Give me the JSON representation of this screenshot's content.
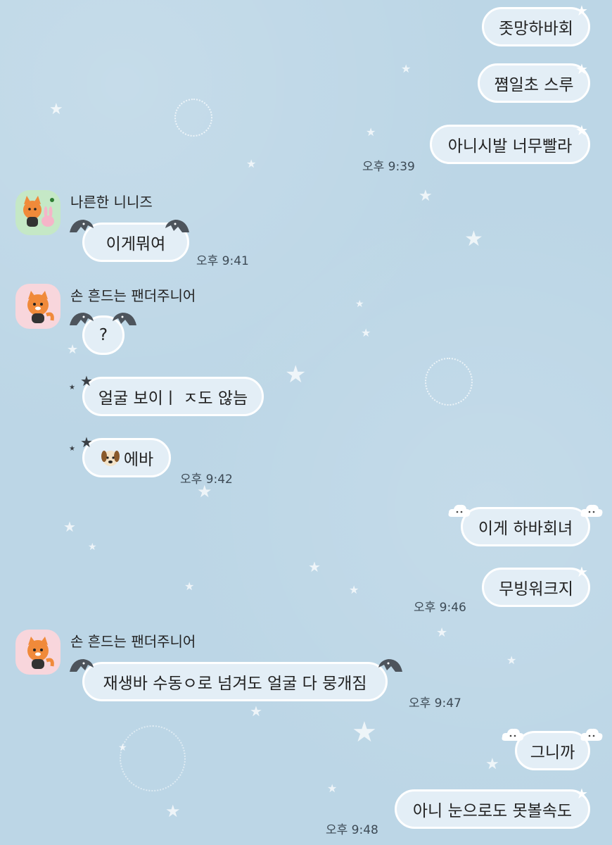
{
  "theme": {
    "background": "#bcd6e6",
    "bubble": "#e3eef6",
    "bubble_border": "#ffffff",
    "text": "#222222"
  },
  "messages": {
    "m1": "좃망하바회",
    "m2": "쪔일초 스루",
    "m3": "아니시발 너무빨라",
    "t1": "오후 9:39",
    "sender1": "나른한 니니즈",
    "m4": "이게뭐여",
    "t2": "오후 9:41",
    "sender2": "손 흔드는 팬더주니어",
    "m5": "?",
    "m6": "얼굴 보이ㅣ ㅈ도 않늠",
    "m7": "에바",
    "t3": "오후 9:42",
    "m8": "이게 하바회녀",
    "m9": "무빙워크지",
    "t4": "오후 9:46",
    "sender3": "손 흔드는 팬더주니어",
    "m10": "재생바 수동ㅇ로 넘겨도 얼굴 다 뭉개짐",
    "t5": "오후 9:47",
    "m11": "그니까",
    "m12": "아니 눈으로도 못볼속도",
    "t6": "오후 9:48"
  },
  "icons": {
    "avatar1": "fox-and-rabbit-avatar",
    "avatar2": "red-panda-avatar",
    "emoji": "dog-face-emoji",
    "bubble_decor": [
      "bat-wing-icon",
      "star-icon",
      "cloud-icon"
    ]
  }
}
